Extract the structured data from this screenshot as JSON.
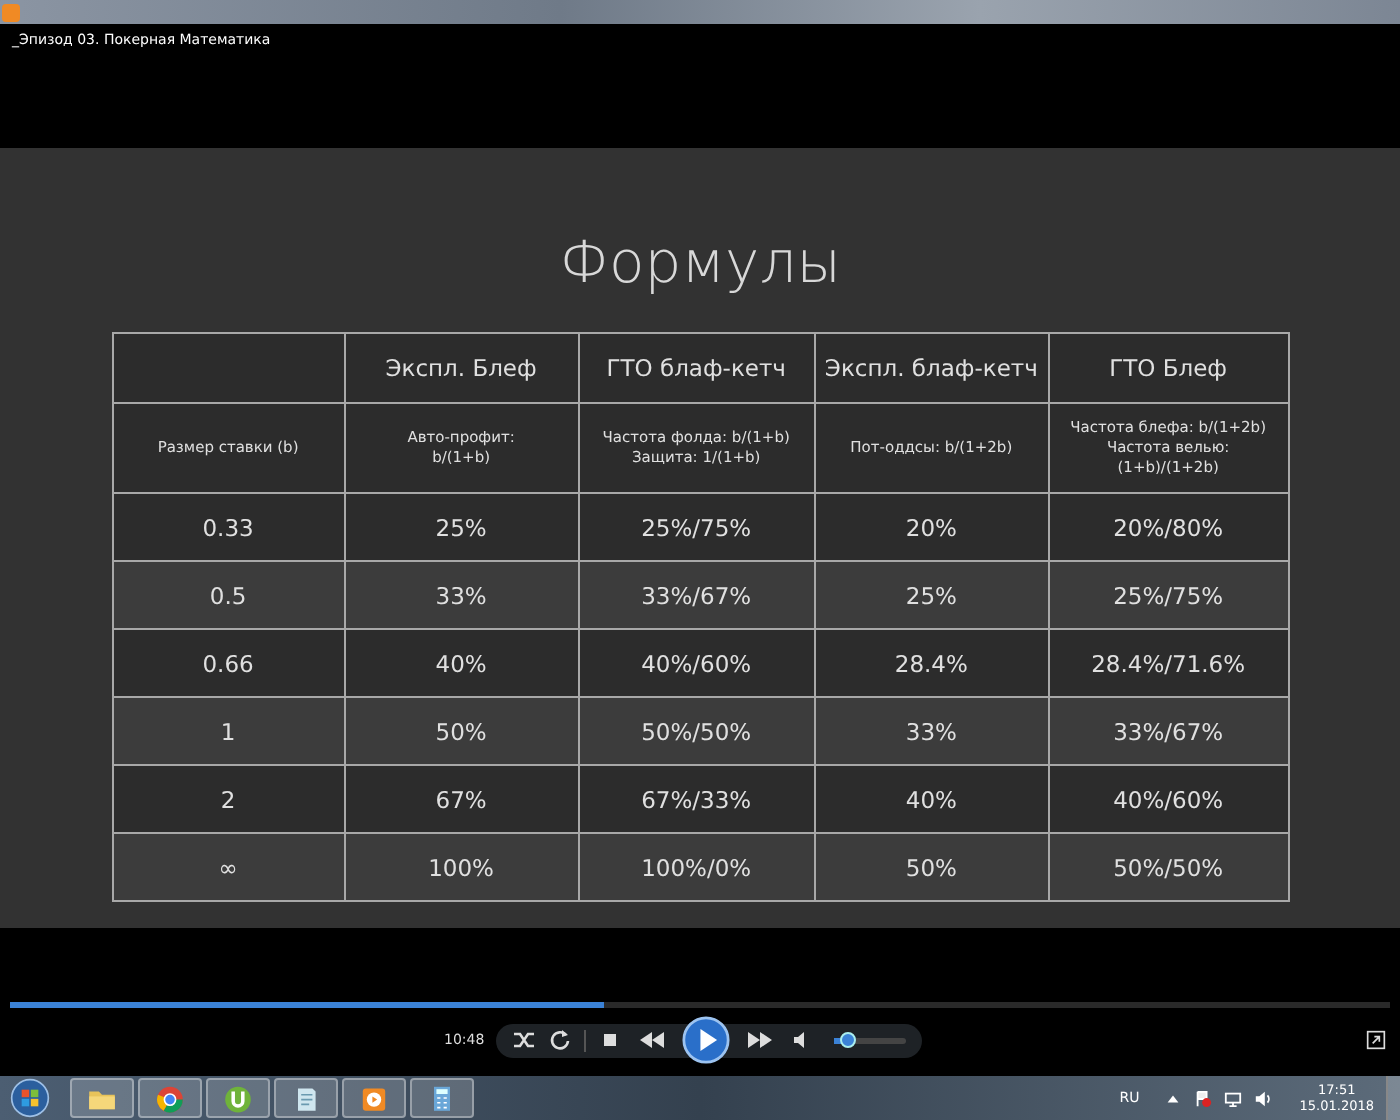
{
  "window": {
    "title": "_Эпизод 03. Покерная Математика"
  },
  "slide": {
    "title": "Формулы",
    "table": {
      "columns": [
        "",
        "Экспл. Блеф",
        "ГТО блаф-кетч",
        "Экспл. блаф-кетч",
        "ГТО Блеф"
      ],
      "subheader": [
        "Размер ставки (b)",
        "Авто-профит:\nb/(1+b)",
        "Частота фолда: b/(1+b)\nЗащита: 1/(1+b)",
        "Пот-оддсы: b/(1+2b)",
        "Частота блефа: b/(1+2b)\nЧастота велью:\n(1+b)/(1+2b)"
      ],
      "rows": [
        [
          "0.33",
          "25%",
          "25%/75%",
          "20%",
          "20%/80%"
        ],
        [
          "0.5",
          "33%",
          "33%/67%",
          "25%",
          "25%/75%"
        ],
        [
          "0.66",
          "40%",
          "40%/60%",
          "28.4%",
          "28.4%/71.6%"
        ],
        [
          "1",
          "50%",
          "50%/50%",
          "33%",
          "33%/67%"
        ],
        [
          "2",
          "67%",
          "67%/33%",
          "40%",
          "40%/60%"
        ],
        [
          "∞",
          "100%",
          "100%/0%",
          "50%",
          "50%/50%"
        ]
      ]
    }
  },
  "player": {
    "progress": {
      "level": 0.43
    },
    "time": "10:48",
    "volume": {
      "level": 0.2
    }
  },
  "taskbar": {
    "apps": [
      {
        "kind": "folder"
      },
      {
        "kind": "browser"
      },
      {
        "kind": "torrent"
      },
      {
        "kind": "notepad"
      },
      {
        "kind": "media"
      },
      {
        "kind": "calculator"
      }
    ],
    "language": "RU",
    "clock": "17:51",
    "date": "15.01.2018"
  }
}
